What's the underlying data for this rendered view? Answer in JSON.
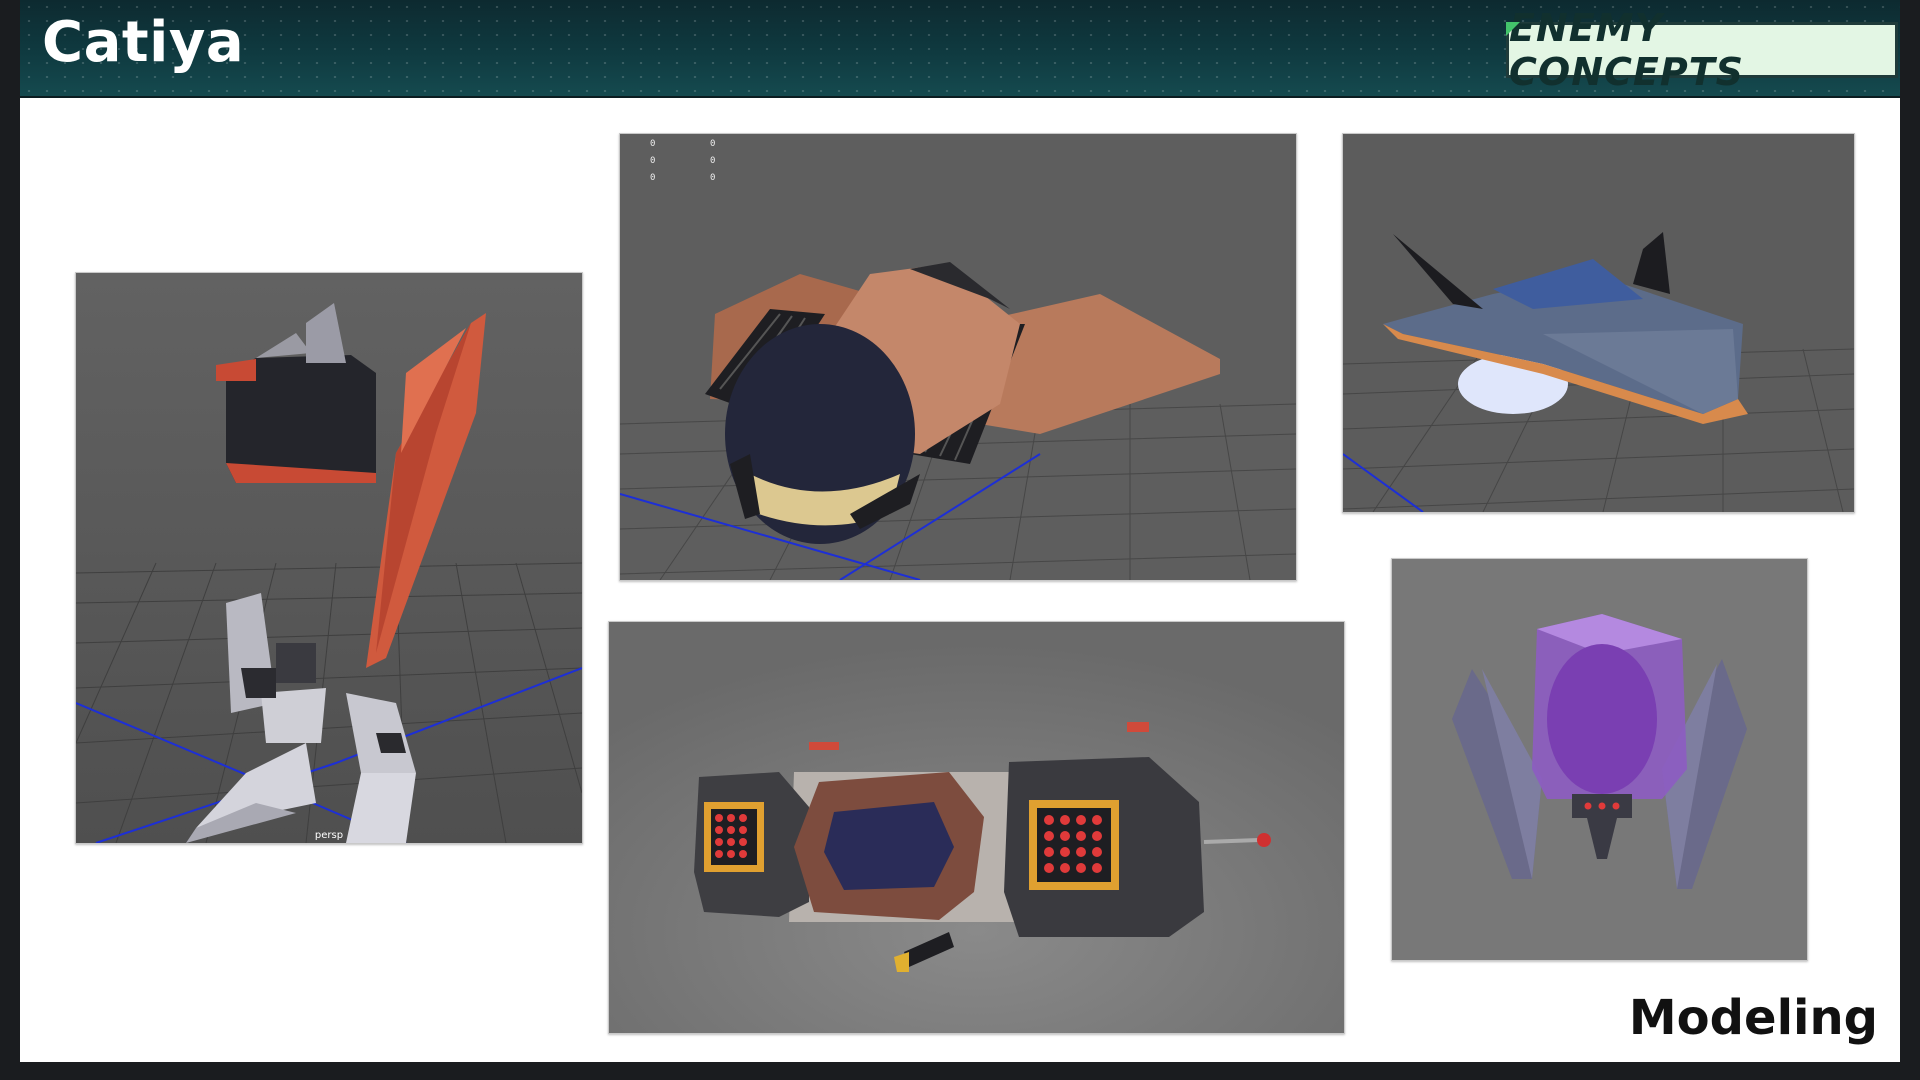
{
  "header": {
    "title": "Catiya",
    "badge": "ENEMY CONCEPTS"
  },
  "footer": {
    "label": "Modeling"
  },
  "panels": {
    "robot": {
      "view_label": "persp"
    },
    "ship_orange": {
      "readout": [
        "0",
        "0",
        "0",
        "0",
        "0",
        "0"
      ]
    },
    "ship_blue": {},
    "pods": {},
    "crystal": {}
  },
  "colors": {
    "header_bg": "#0f3a40",
    "badge_bg": "#e3f6e4",
    "viewport_gray": "#5b5b5b",
    "accent_orange": "#d0583c",
    "grid_axis_blue": "#1d2fd6"
  }
}
